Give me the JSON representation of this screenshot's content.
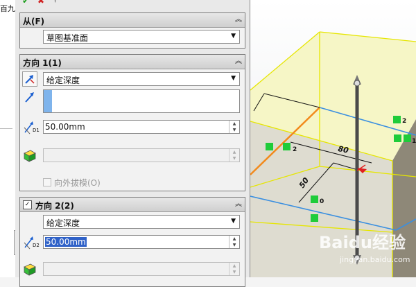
{
  "left_strip_label": "百九",
  "toolbar": {
    "ok_icon": "check-icon",
    "cancel_icon": "x-icon",
    "pin_icon": "pushpin-icon"
  },
  "from_group": {
    "title": "从(F)",
    "start_condition": "草图基准面"
  },
  "direction1": {
    "title": "方向 1(1)",
    "end_condition": "给定深度",
    "depth": "50.00mm",
    "depth_icon_label": "D1",
    "draft_outward_label": "向外拔模(O)"
  },
  "direction2": {
    "title": "方向 2(2)",
    "checked": true,
    "end_condition": "给定深度",
    "depth": "50.00mm",
    "depth_icon_label": "D2"
  },
  "viewport": {
    "dimension_labels": [
      "80",
      "50"
    ],
    "relation_labels": [
      "2",
      "2",
      "1",
      "0"
    ],
    "colors": {
      "preview_fill": "#f3f3b4",
      "edge_yellow": "#e6e600",
      "sketch_blue": "#3a8fe0",
      "sketch_orange": "#f28a1c",
      "relation_green": "#1fcc3a"
    }
  },
  "watermark": {
    "brand": "Baidu经验",
    "url": "jingyan.baidu.com"
  }
}
